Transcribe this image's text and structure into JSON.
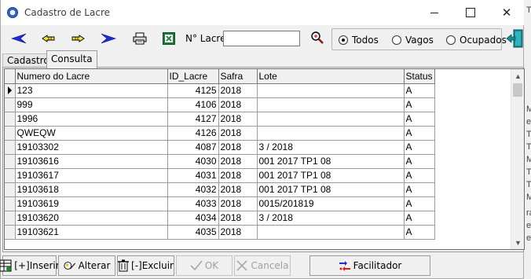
{
  "window": {
    "title": "Cadastro de Lacre"
  },
  "background_app": {
    "letters": [
      "Tc",
      "M",
      "es",
      "Tc",
      "Tc",
      "M",
      "Tc",
      "Tc",
      "M",
      "ra",
      "es",
      "es"
    ]
  },
  "toolbar": {
    "first_icon": "first-record-icon",
    "prev_icon": "previous-record-icon",
    "next_icon": "next-record-icon",
    "last_icon": "last-record-icon",
    "print_icon": "print-icon",
    "excel_icon": "excel-icon",
    "lacre_label": "N° Lacre",
    "lacre_value": "",
    "search_icon": "zoom-search-icon",
    "filter_options": [
      {
        "label": "Todos",
        "selected": true
      },
      {
        "label": "Vagos",
        "selected": false
      },
      {
        "label": "Ocupados",
        "selected": false
      }
    ],
    "exit_icon": "exit-door-icon"
  },
  "tabs": [
    {
      "label": "Cadastro",
      "active": false
    },
    {
      "label": "Consulta",
      "active": true
    }
  ],
  "grid": {
    "columns": [
      "Numero do Lacre",
      "ID_Lacre",
      "Safra",
      "Lote",
      "Status"
    ],
    "current_row": 0,
    "rows": [
      [
        "123",
        "4125",
        "2018",
        "",
        "A"
      ],
      [
        "999",
        "4106",
        "2018",
        "",
        "A"
      ],
      [
        "1996",
        "4127",
        "2018",
        "",
        "A"
      ],
      [
        "QWEQW",
        "4126",
        "2018",
        "",
        "A"
      ],
      [
        "19103302",
        "4087",
        "2018",
        "3 / 2018",
        "A"
      ],
      [
        "19103616",
        "4030",
        "2018",
        "001 2017 TP1 08",
        "A"
      ],
      [
        "19103617",
        "4031",
        "2018",
        "001 2017 TP1 08",
        "A"
      ],
      [
        "19103618",
        "4032",
        "2018",
        "001 2017 TP1 08",
        "A"
      ],
      [
        "19103619",
        "4033",
        "2018",
        "0015/201819",
        "A"
      ],
      [
        "19103620",
        "4034",
        "2018",
        "3 / 2018",
        "A"
      ],
      [
        "19103621",
        "4035",
        "2018",
        "",
        "A"
      ]
    ]
  },
  "buttons": {
    "insert": "[+]Inserir",
    "edit": "Alterar",
    "delete": "[-]Excluir",
    "ok": "OK",
    "cancel": "Cancela",
    "facilitator": "Facilitador"
  },
  "colors": {
    "nav_arrow": "#1f2bd6",
    "excel_green": "#1d7a3a",
    "exit_teal": "#1b8a95"
  }
}
